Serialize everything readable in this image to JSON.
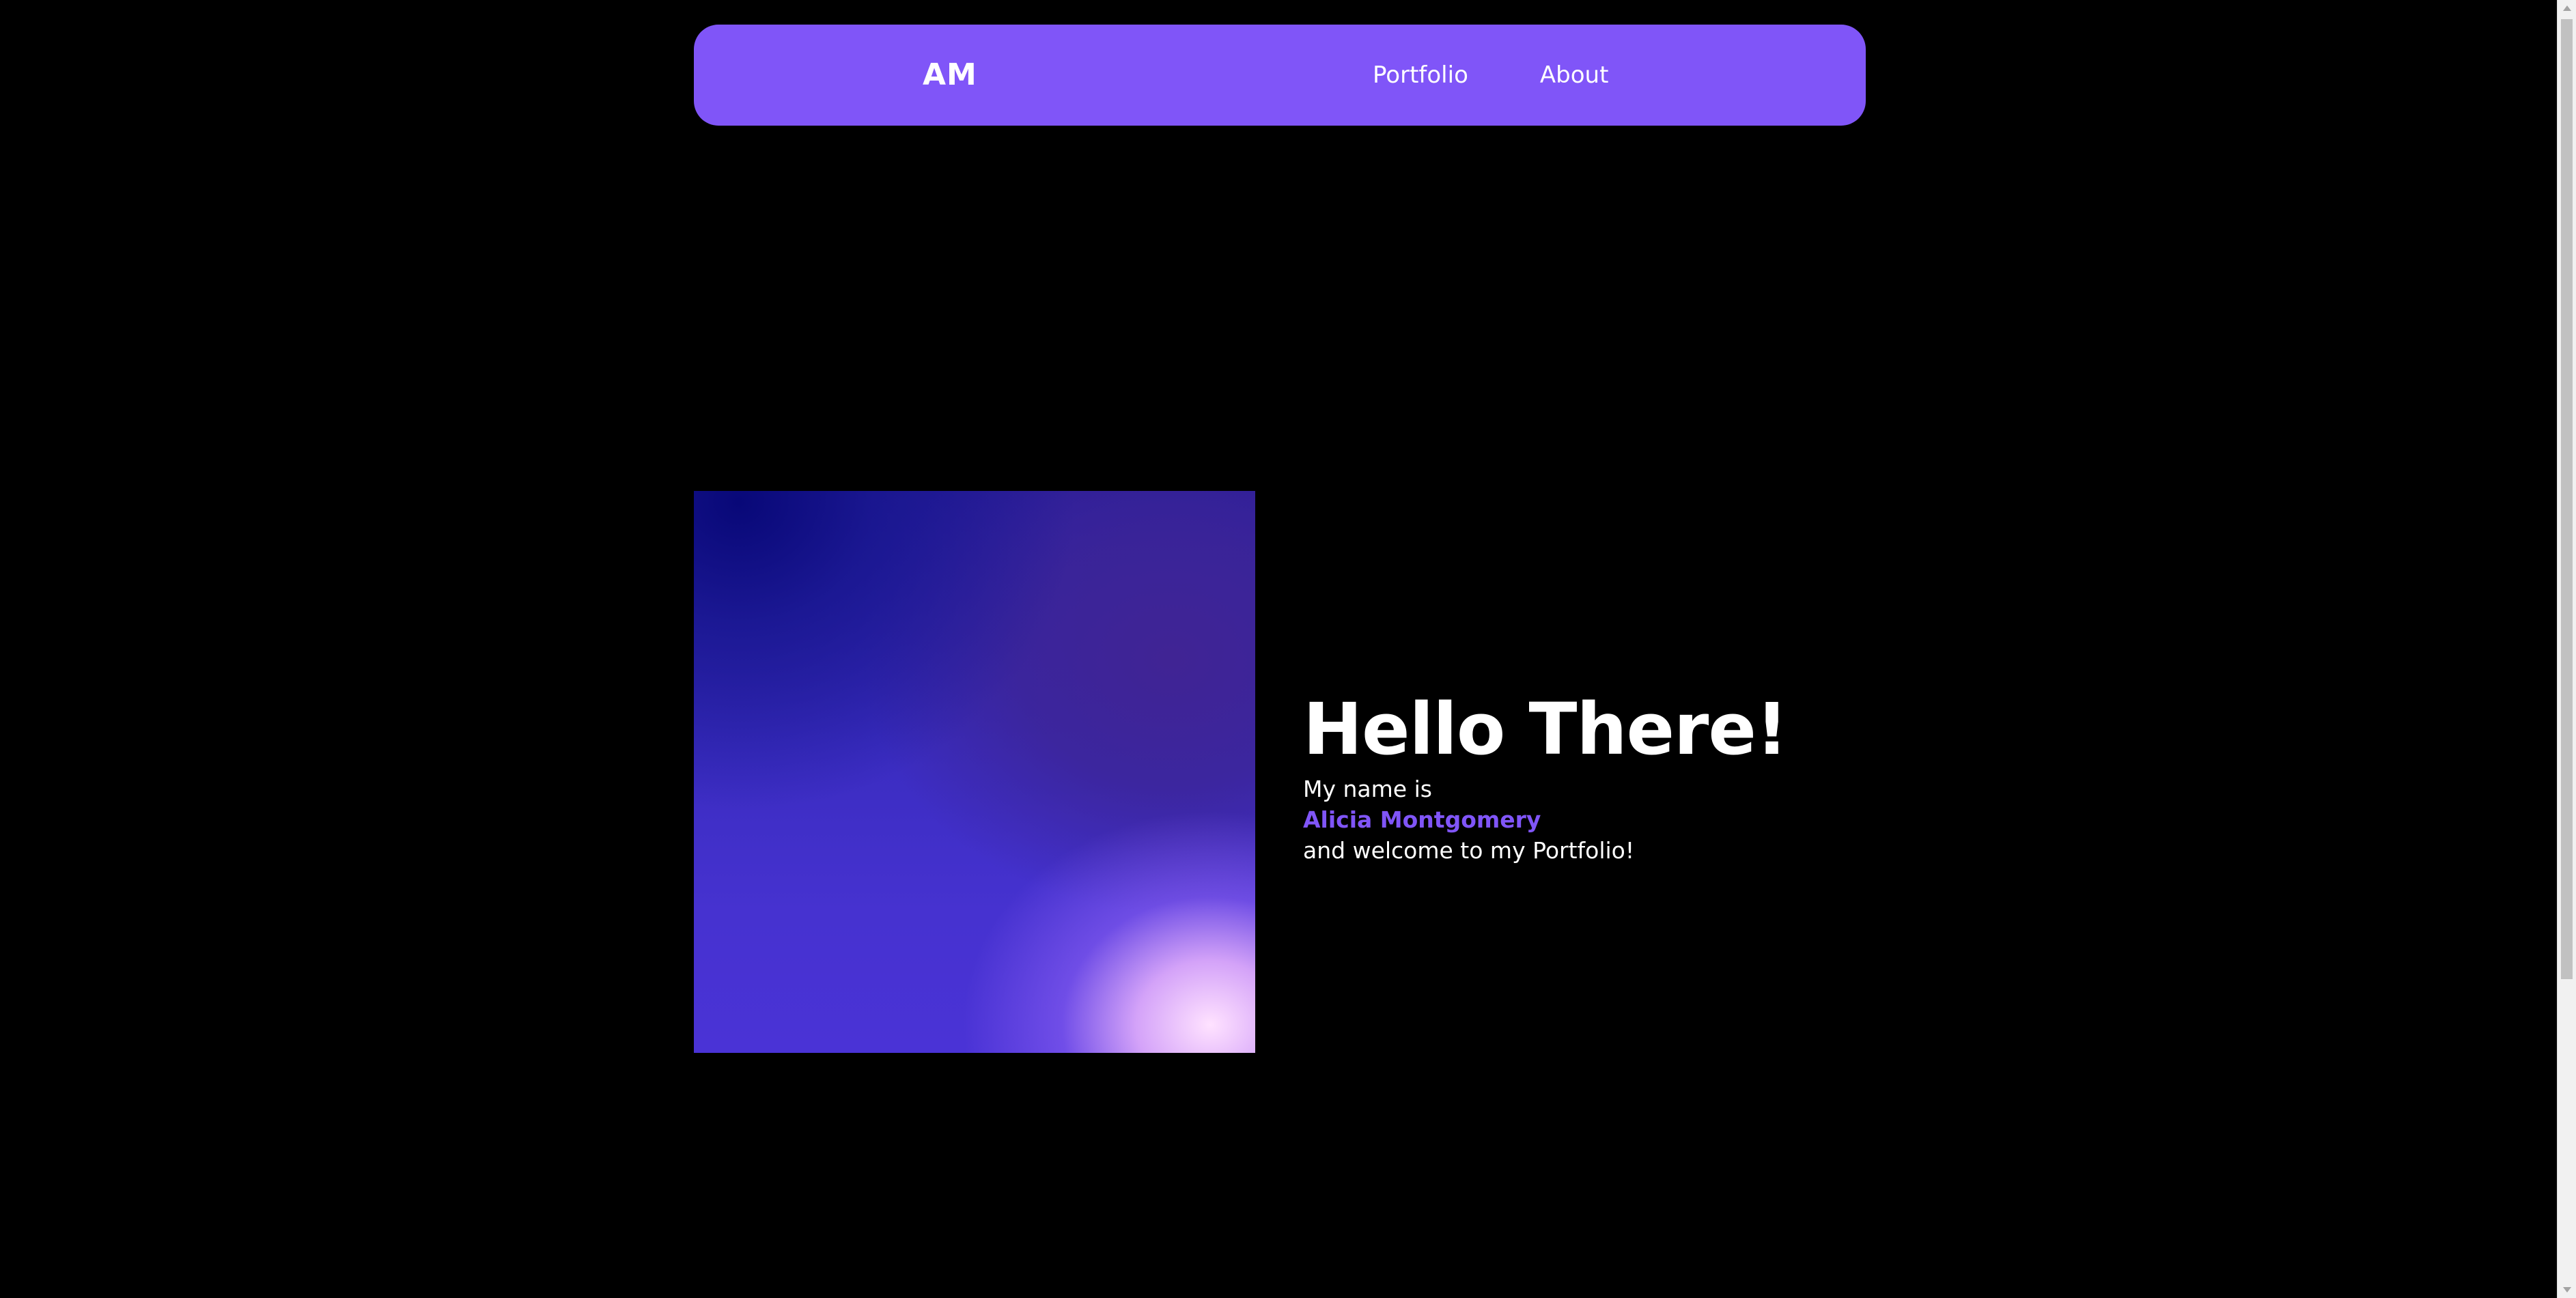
{
  "colors": {
    "background": "#000000",
    "accent": "#8055f8",
    "text": "#ffffff"
  },
  "navbar": {
    "logo": "AM",
    "links": [
      {
        "label": "Portfolio"
      },
      {
        "label": "About"
      }
    ]
  },
  "hero": {
    "title": "Hello There!",
    "intro": "My name is",
    "name": "Alicia Montgomery",
    "outro": "and welcome to my Portfolio!"
  }
}
